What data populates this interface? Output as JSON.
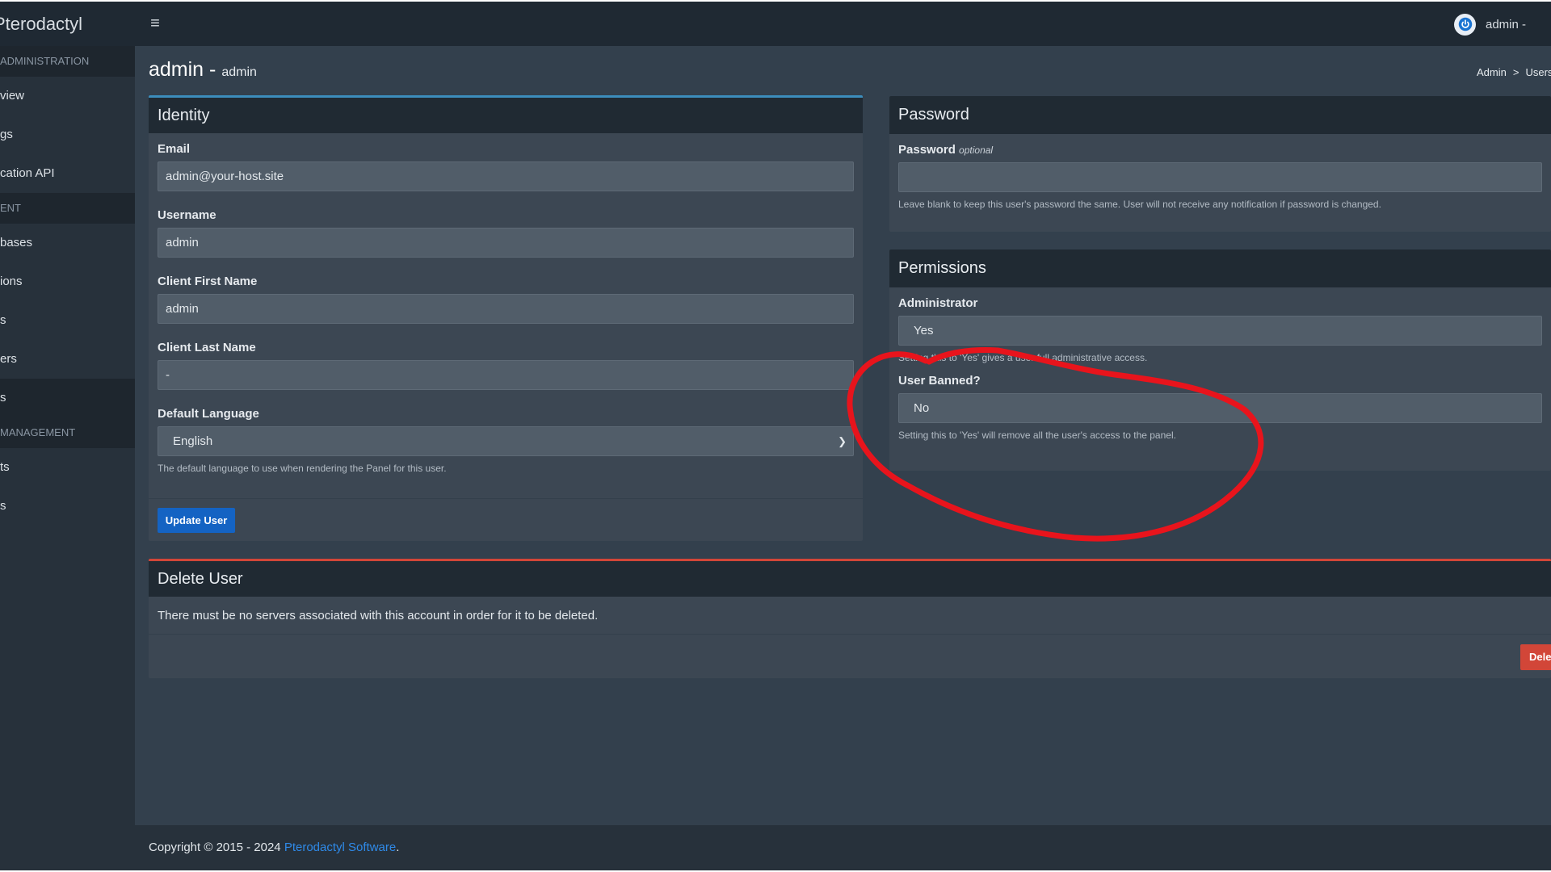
{
  "app": {
    "brand": "Pterodactyl"
  },
  "topbar": {
    "user_name": "admin -"
  },
  "sidebar": {
    "sections": [
      {
        "header": "ADMINISTRATION",
        "items": [
          "view",
          "gs",
          "cation API"
        ]
      },
      {
        "header": "ENT",
        "items": [
          "bases",
          "ions",
          "s",
          "ers",
          "s"
        ]
      },
      {
        "header": "MANAGEMENT",
        "items": [
          "ts",
          "s"
        ]
      }
    ],
    "active_item": "s"
  },
  "header": {
    "title": "admin",
    "title_sep": "-",
    "subtitle": "admin",
    "breadcrumb": [
      "Admin",
      "Users"
    ],
    "breadcrumb_sep": ">"
  },
  "identity": {
    "title": "Identity",
    "email_label": "Email",
    "email_value": "admin@your-host.site",
    "username_label": "Username",
    "username_value": "admin",
    "first_name_label": "Client First Name",
    "first_name_value": "admin",
    "last_name_label": "Client Last Name",
    "last_name_value": "-",
    "language_label": "Default Language",
    "language_value": "English",
    "language_help": "The default language to use when rendering the Panel for this user.",
    "update_label": "Update User"
  },
  "password": {
    "title": "Password",
    "label": "Password",
    "optional": "optional",
    "value": "",
    "help": "Leave blank to keep this user's password the same. User will not receive any notification if password is changed."
  },
  "permissions": {
    "title": "Permissions",
    "admin_label": "Administrator",
    "admin_value": "Yes",
    "admin_help": "Setting this to 'Yes' gives a user full administrative access.",
    "banned_label": "User Banned?",
    "banned_value": "No",
    "banned_help": "Setting this to 'Yes' will remove all the user's access to the panel."
  },
  "delete_user": {
    "title": "Delete User",
    "message": "There must be no servers associated with this account in order for it to be deleted.",
    "button_label": "Delete"
  },
  "footer": {
    "copyright": "Copyright © 2015 - 2024",
    "link_text": "Pterodactyl Software",
    "suffix": "."
  },
  "colors": {
    "accent_blue": "#2f8ae8",
    "primary_button": "#1463c3",
    "danger": "#d24638",
    "annotation_red": "#e8141c"
  },
  "icons": {
    "menu": "hamburger-icon",
    "user": "power-icon",
    "select": "chevron-down-icon"
  }
}
